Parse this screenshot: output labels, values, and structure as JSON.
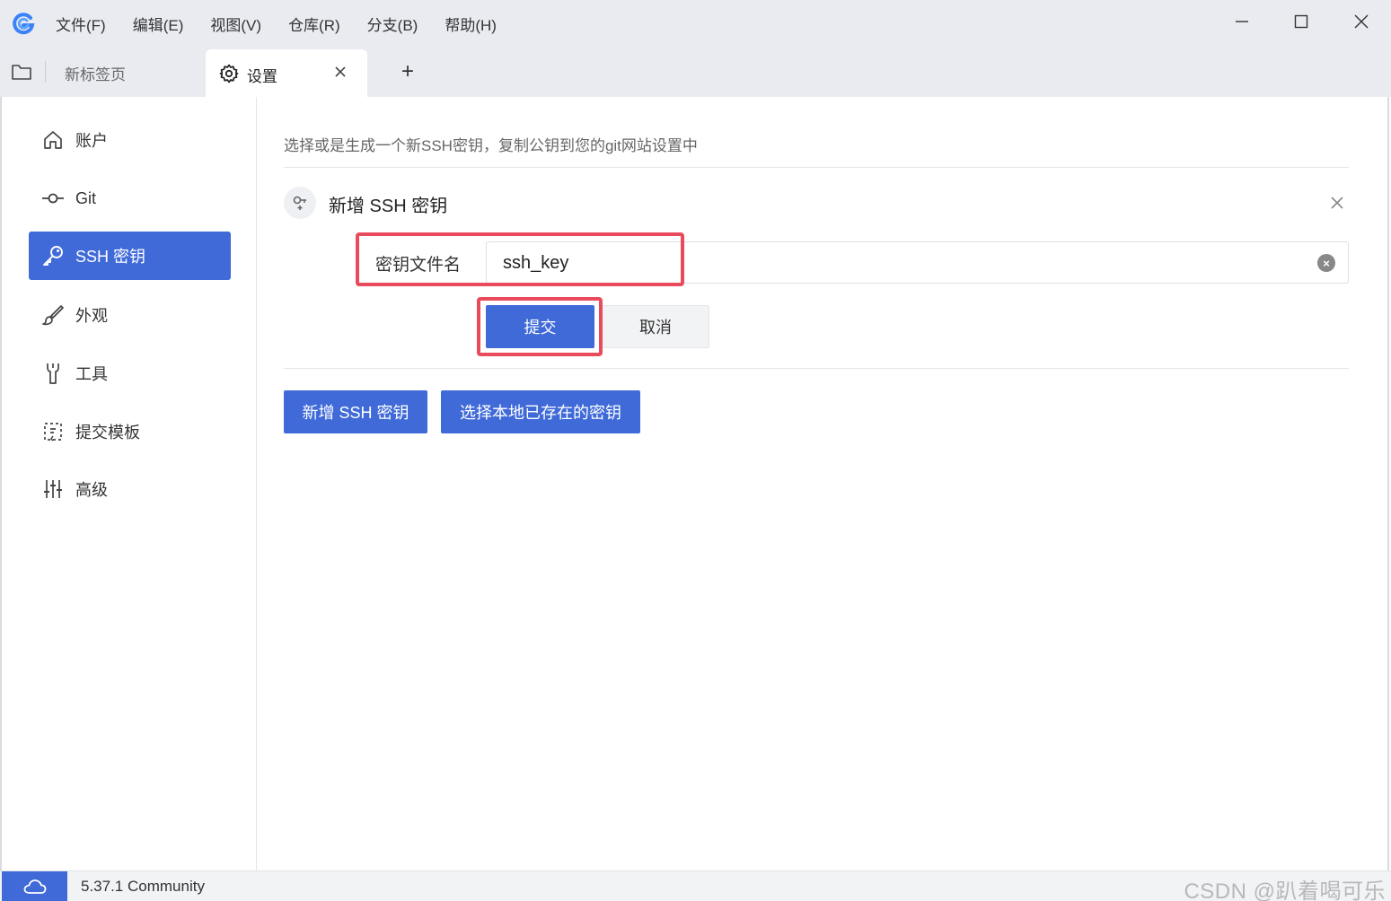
{
  "app": {
    "logo_icon": "app-logo-g",
    "menu": [
      "文件(F)",
      "编辑(E)",
      "视图(V)",
      "仓库(R)",
      "分支(B)",
      "帮助(H)"
    ]
  },
  "tabs": {
    "new_tab_label": "新标签页",
    "active_tab_label": "设置",
    "add_symbol": "+"
  },
  "sidebar": {
    "items": [
      {
        "label": "账户",
        "icon": "home-icon"
      },
      {
        "label": "Git",
        "icon": "git-commit-icon"
      },
      {
        "label": "SSH 密钥",
        "icon": "key-icon"
      },
      {
        "label": "外观",
        "icon": "brush-icon"
      },
      {
        "label": "工具",
        "icon": "wrench-icon"
      },
      {
        "label": "提交模板",
        "icon": "template-icon"
      },
      {
        "label": "高级",
        "icon": "sliders-icon"
      }
    ],
    "active_index": 2
  },
  "main": {
    "description": "选择或是生成一个新SSH密钥，复制公钥到您的git网站设置中",
    "panel_title": "新增 SSH 密钥",
    "field_label": "密钥文件名",
    "field_value": "ssh_key",
    "submit_label": "提交",
    "cancel_label": "取消",
    "add_key_label": "新增 SSH 密钥",
    "choose_local_label": "选择本地已存在的密钥"
  },
  "status": {
    "version": "5.37.1 Community",
    "watermark": "CSDN @趴着喝可乐"
  },
  "colors": {
    "accent": "#3f6ad8",
    "highlight": "#e94b5c",
    "chrome_bg": "#e9ebf1"
  }
}
